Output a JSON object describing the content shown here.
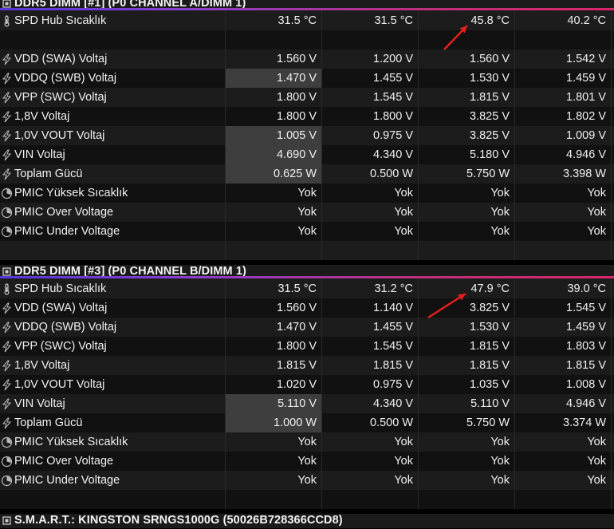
{
  "sections": [
    {
      "title": "DDR5 DIMM [#1] (P0 CHANNEL A/DIMM 1)",
      "rows": [
        {
          "label": "SPD Hub Sıcaklık",
          "icon": "thermometer-icon",
          "values": [
            "31.5 °C",
            "31.5 °C",
            "45.8 °C",
            "40.2 °C"
          ]
        },
        {
          "label": "",
          "icon": "",
          "values": [
            "",
            "",
            "",
            ""
          ]
        },
        {
          "label": "VDD (SWA) Voltaj",
          "icon": "lightning-icon",
          "values": [
            "1.560 V",
            "1.200 V",
            "1.560 V",
            "1.542 V"
          ]
        },
        {
          "label": "VDDQ (SWB) Voltaj",
          "icon": "lightning-icon",
          "values": [
            "1.470 V",
            "1.455 V",
            "1.530 V",
            "1.459 V"
          ]
        },
        {
          "label": "VPP (SWC) Voltaj",
          "icon": "lightning-icon",
          "values": [
            "1.800 V",
            "1.545 V",
            "1.815 V",
            "1.801 V"
          ]
        },
        {
          "label": "1,8V Voltaj",
          "icon": "lightning-icon",
          "values": [
            "1.800 V",
            "1.800 V",
            "3.825 V",
            "1.802 V"
          ]
        },
        {
          "label": "1,0V VOUT Voltaj",
          "icon": "lightning-icon",
          "values": [
            "1.005 V",
            "0.975 V",
            "3.825 V",
            "1.009 V"
          ]
        },
        {
          "label": "VIN Voltaj",
          "icon": "lightning-icon",
          "values": [
            "4.690 V",
            "4.340 V",
            "5.180 V",
            "4.946 V"
          ]
        },
        {
          "label": "Toplam Gücü",
          "icon": "lightning-icon",
          "values": [
            "0.625 W",
            "0.500 W",
            "5.750 W",
            "3.398 W"
          ]
        },
        {
          "label": "PMIC Yüksek Sıcaklık",
          "icon": "clock-icon",
          "values": [
            "Yok",
            "Yok",
            "Yok",
            "Yok"
          ]
        },
        {
          "label": "PMIC Over Voltage",
          "icon": "clock-icon",
          "values": [
            "Yok",
            "Yok",
            "Yok",
            "Yok"
          ]
        },
        {
          "label": "PMIC Under Voltage",
          "icon": "clock-icon",
          "values": [
            "Yok",
            "Yok",
            "Yok",
            "Yok"
          ]
        },
        {
          "label": "",
          "icon": "",
          "values": [
            "",
            "",
            "",
            ""
          ]
        }
      ]
    },
    {
      "title": "DDR5 DIMM [#3] (P0 CHANNEL B/DIMM 1)",
      "rows": [
        {
          "label": "SPD Hub Sıcaklık",
          "icon": "thermometer-icon",
          "values": [
            "31.5 °C",
            "31.2 °C",
            "47.9 °C",
            "39.0 °C"
          ]
        },
        {
          "label": "VDD (SWA) Voltaj",
          "icon": "lightning-icon",
          "values": [
            "1.560 V",
            "1.140 V",
            "3.825 V",
            "1.545 V"
          ]
        },
        {
          "label": "VDDQ (SWB) Voltaj",
          "icon": "lightning-icon",
          "values": [
            "1.470 V",
            "1.455 V",
            "1.530 V",
            "1.459 V"
          ]
        },
        {
          "label": "VPP (SWC) Voltaj",
          "icon": "lightning-icon",
          "values": [
            "1.800 V",
            "1.545 V",
            "1.815 V",
            "1.803 V"
          ]
        },
        {
          "label": "1,8V Voltaj",
          "icon": "lightning-icon",
          "values": [
            "1.815 V",
            "1.815 V",
            "1.815 V",
            "1.815 V"
          ]
        },
        {
          "label": "1,0V VOUT Voltaj",
          "icon": "lightning-icon",
          "values": [
            "1.020 V",
            "0.975 V",
            "1.035 V",
            "1.008 V"
          ]
        },
        {
          "label": "VIN Voltaj",
          "icon": "lightning-icon",
          "values": [
            "5.110 V",
            "4.340 V",
            "5.110 V",
            "4.946 V"
          ]
        },
        {
          "label": "Toplam Gücü",
          "icon": "lightning-icon",
          "values": [
            "1.000 W",
            "0.500 W",
            "5.750 W",
            "3.374 W"
          ]
        },
        {
          "label": "PMIC Yüksek Sıcaklık",
          "icon": "clock-icon",
          "values": [
            "Yok",
            "Yok",
            "Yok",
            "Yok"
          ]
        },
        {
          "label": "PMIC Over Voltage",
          "icon": "clock-icon",
          "values": [
            "Yok",
            "Yok",
            "Yok",
            "Yok"
          ]
        },
        {
          "label": "PMIC Under Voltage",
          "icon": "clock-icon",
          "values": [
            "Yok",
            "Yok",
            "Yok",
            "Yok"
          ]
        },
        {
          "label": "",
          "icon": "",
          "values": [
            "",
            "",
            "",
            ""
          ]
        }
      ]
    },
    {
      "title": "S.M.A.R.T.: KINGSTON SRNGS1000G (50026B728366CCD8)",
      "rows": []
    }
  ],
  "colors": {
    "accent_start": "#5438d8",
    "accent_end": "#d8266a",
    "arrow": "#e0201c"
  }
}
